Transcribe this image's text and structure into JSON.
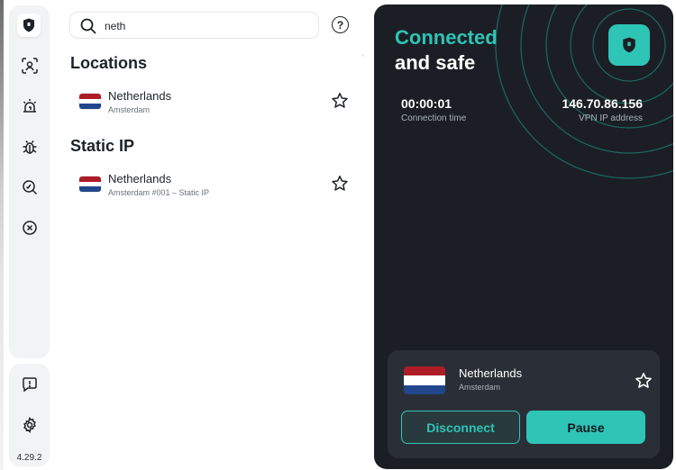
{
  "sidebar": {
    "version": "4.29.2",
    "items": [
      {
        "icon": "shield-icon",
        "active": true
      },
      {
        "icon": "face-scan-icon"
      },
      {
        "icon": "alarm-icon"
      },
      {
        "icon": "bug-icon"
      },
      {
        "icon": "search-scan-icon"
      },
      {
        "icon": "block-icon"
      }
    ],
    "bottom_items": [
      {
        "icon": "feedback-icon"
      },
      {
        "icon": "gear-icon"
      }
    ]
  },
  "search": {
    "value": "neth",
    "placeholder": ""
  },
  "sections": {
    "locations": {
      "title": "Locations",
      "items": [
        {
          "name": "Netherlands",
          "sub": "Amsterdam"
        }
      ]
    },
    "static_ip": {
      "title": "Static IP",
      "items": [
        {
          "name": "Netherlands",
          "sub": "Amsterdam #001 – Static IP"
        }
      ]
    }
  },
  "vpn": {
    "status_line1": "Connected",
    "status_line2": "and safe",
    "connection_time": "00:00:01",
    "connection_time_label": "Connection time",
    "ip": "146.70.86.156",
    "ip_label": "VPN IP address",
    "current": {
      "name": "Netherlands",
      "sub": "Amsterdam"
    },
    "disconnect_label": "Disconnect",
    "pause_label": "Pause"
  },
  "colors": {
    "accent": "#2ec4b6",
    "panel": "#1b1f25",
    "card": "#2a2f37",
    "flag_red": "#ae1c28",
    "flag_white": "#ffffff",
    "flag_blue": "#21468b"
  }
}
